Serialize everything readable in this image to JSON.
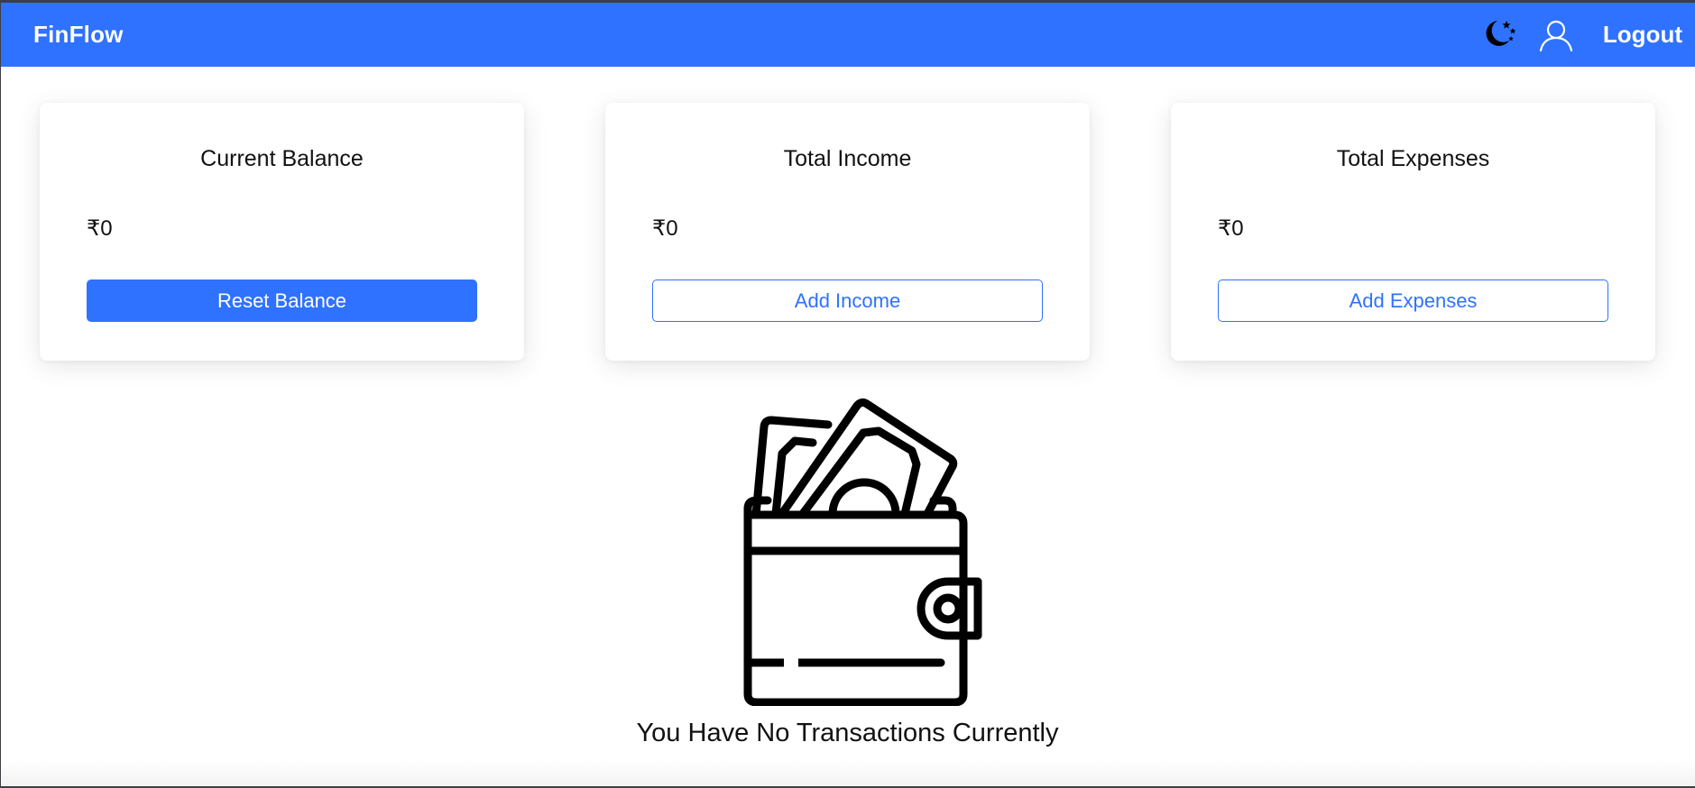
{
  "navbar": {
    "brand": "FinFlow",
    "theme_icon": "moon-stars-icon",
    "user_icon": "user-icon",
    "logout_label": "Logout",
    "background": "#2f72ff"
  },
  "cards": [
    {
      "title": "Current Balance",
      "value": "₹0",
      "button_label": "Reset Balance",
      "button_style": "solid"
    },
    {
      "title": "Total Income",
      "value": "₹0",
      "button_label": "Add Income",
      "button_style": "outline"
    },
    {
      "title": "Total Expenses",
      "value": "₹0",
      "button_label": "Add Expenses",
      "button_style": "outline"
    }
  ],
  "empty_state": {
    "icon": "wallet-icon",
    "message": "You Have No Transactions Currently"
  },
  "colors": {
    "accent": "#2f72ff",
    "text": "#111111",
    "card_bg": "#ffffff"
  }
}
